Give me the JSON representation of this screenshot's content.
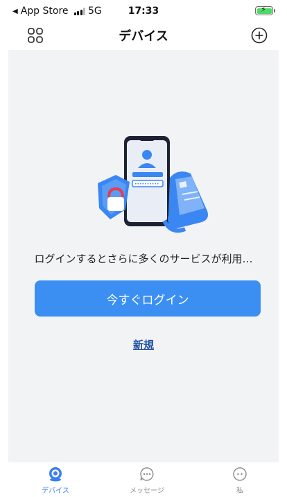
{
  "status_bar": {
    "back_app": "App Store",
    "network": "5G",
    "time": "17:33"
  },
  "header": {
    "title": "デバイス"
  },
  "main": {
    "message": "ログインするとさらに多くのサービスが利用…",
    "login_button": "今すぐログイン",
    "register_link": "新規"
  },
  "tabs": [
    {
      "label": "デバイス",
      "icon": "device-icon",
      "active": true
    },
    {
      "label": "メッセージ",
      "icon": "message-icon",
      "active": false
    },
    {
      "label": "私",
      "icon": "profile-icon",
      "active": false
    }
  ],
  "colors": {
    "accent": "#3b8ff3",
    "link": "#1f4fa3",
    "background": "#f2f3f5",
    "tab_active": "#3b7ff0"
  }
}
